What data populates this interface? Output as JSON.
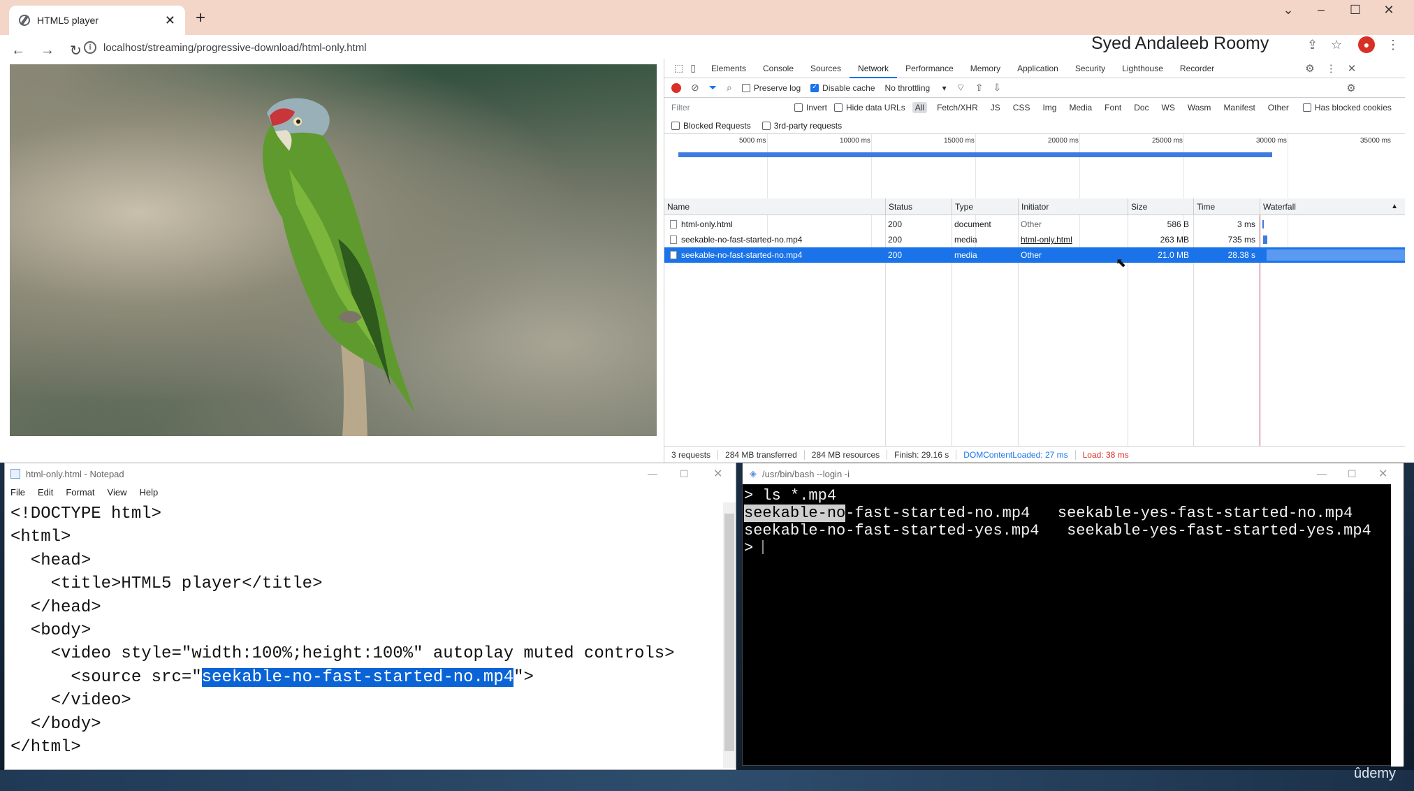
{
  "browser": {
    "tab_title": "HTML5 player",
    "url": "localhost/streaming/progressive-download/html-only.html",
    "author_overlay": "Syed Andaleeb Roomy",
    "new_tab": "+"
  },
  "devtools": {
    "tabs": [
      "Elements",
      "Console",
      "Sources",
      "Network",
      "Performance",
      "Memory",
      "Application",
      "Security",
      "Lighthouse",
      "Recorder"
    ],
    "active_tab": "Network",
    "toolbar": {
      "preserve_log": "Preserve log",
      "disable_cache": "Disable cache",
      "throttling": "No throttling"
    },
    "filter_placeholder": "Filter",
    "filter_options": {
      "invert": "Invert",
      "hide_data_urls": "Hide data URLs",
      "has_blocked_cookies": "Has blocked cookies"
    },
    "type_filters": [
      "All",
      "Fetch/XHR",
      "JS",
      "CSS",
      "Img",
      "Media",
      "Font",
      "Doc",
      "WS",
      "Wasm",
      "Manifest",
      "Other"
    ],
    "blocked_requests": "Blocked Requests",
    "third_party": "3rd-party requests",
    "timeline_labels": [
      "5000 ms",
      "10000 ms",
      "15000 ms",
      "20000 ms",
      "25000 ms",
      "30000 ms",
      "35000 ms"
    ],
    "columns": [
      "Name",
      "Status",
      "Type",
      "Initiator",
      "Size",
      "Time",
      "Waterfall"
    ],
    "rows": [
      {
        "name": "html-only.html",
        "status": "200",
        "type": "document",
        "initiator": "Other",
        "size": "586 B",
        "time": "3 ms"
      },
      {
        "name": "seekable-no-fast-started-no.mp4",
        "status": "200",
        "type": "media",
        "initiator": "html-only.html",
        "size": "263 MB",
        "time": "735 ms"
      },
      {
        "name": "seekable-no-fast-started-no.mp4",
        "status": "200",
        "type": "media",
        "initiator": "Other",
        "size": "21.0 MB",
        "time": "28.38 s"
      }
    ],
    "status": {
      "requests": "3 requests",
      "transferred": "284 MB transferred",
      "resources": "284 MB resources",
      "finish": "Finish: 29.16 s",
      "dom_loaded": "DOMContentLoaded: 27 ms",
      "load": "Load: 38 ms"
    },
    "colors": {
      "accent": "#1a73e8",
      "dom": "#1a73e8",
      "load": "#d93025"
    }
  },
  "notepad": {
    "title": "html-only.html - Notepad",
    "menu": [
      "File",
      "Edit",
      "Format",
      "View",
      "Help"
    ],
    "lines": [
      "<!DOCTYPE html>",
      "<html>",
      "  <head>",
      "    <title>HTML5 player</title>",
      "  </head>",
      "  <body>",
      "    <video style=\"width:100%;height:100%\" autoplay muted controls>"
    ],
    "source_prefix": "      <source src=\"",
    "source_selected": "seekable-no-fast-started-no.mp4",
    "source_suffix": "\">",
    "lines_after": [
      "    </video>",
      "  </body>",
      "</html>"
    ]
  },
  "terminal": {
    "title": "/usr/bin/bash --login -i",
    "command": "> ls *.mp4",
    "file1_selected": "seekable-no",
    "file1_rest": "-fast-started-no.mp4",
    "file2": "seekable-yes-fast-started-no.mp4",
    "file3": "seekable-no-fast-started-yes.mp4",
    "file4": "seekable-yes-fast-started-yes.mp4",
    "prompt": ">"
  },
  "watermark": "ûdemy"
}
